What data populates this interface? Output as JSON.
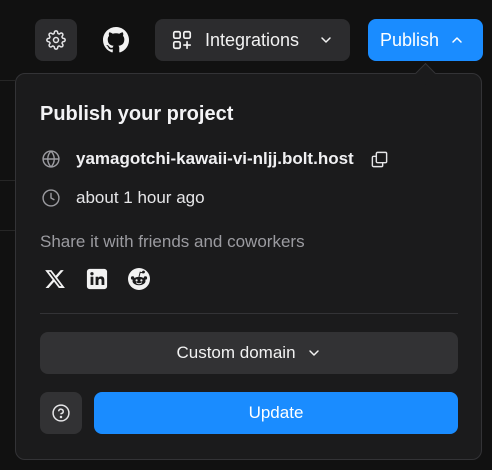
{
  "toolbar": {
    "settings_icon": "gear-icon",
    "github_icon": "github-icon",
    "integrations_label": "Integrations",
    "publish_label": "Publish"
  },
  "popover": {
    "title": "Publish your project",
    "url": "yamagotchi-kawaii-vi-nljj.bolt.host",
    "last_published": "about 1 hour ago",
    "share_text": "Share it with friends and coworkers",
    "social": [
      "x-icon",
      "linkedin-icon",
      "reddit-icon"
    ],
    "custom_domain_label": "Custom domain",
    "update_label": "Update"
  },
  "colors": {
    "accent": "#1a8cff",
    "background": "#111111",
    "panel": "#1b1b1c",
    "button": "#2c2c2e"
  }
}
